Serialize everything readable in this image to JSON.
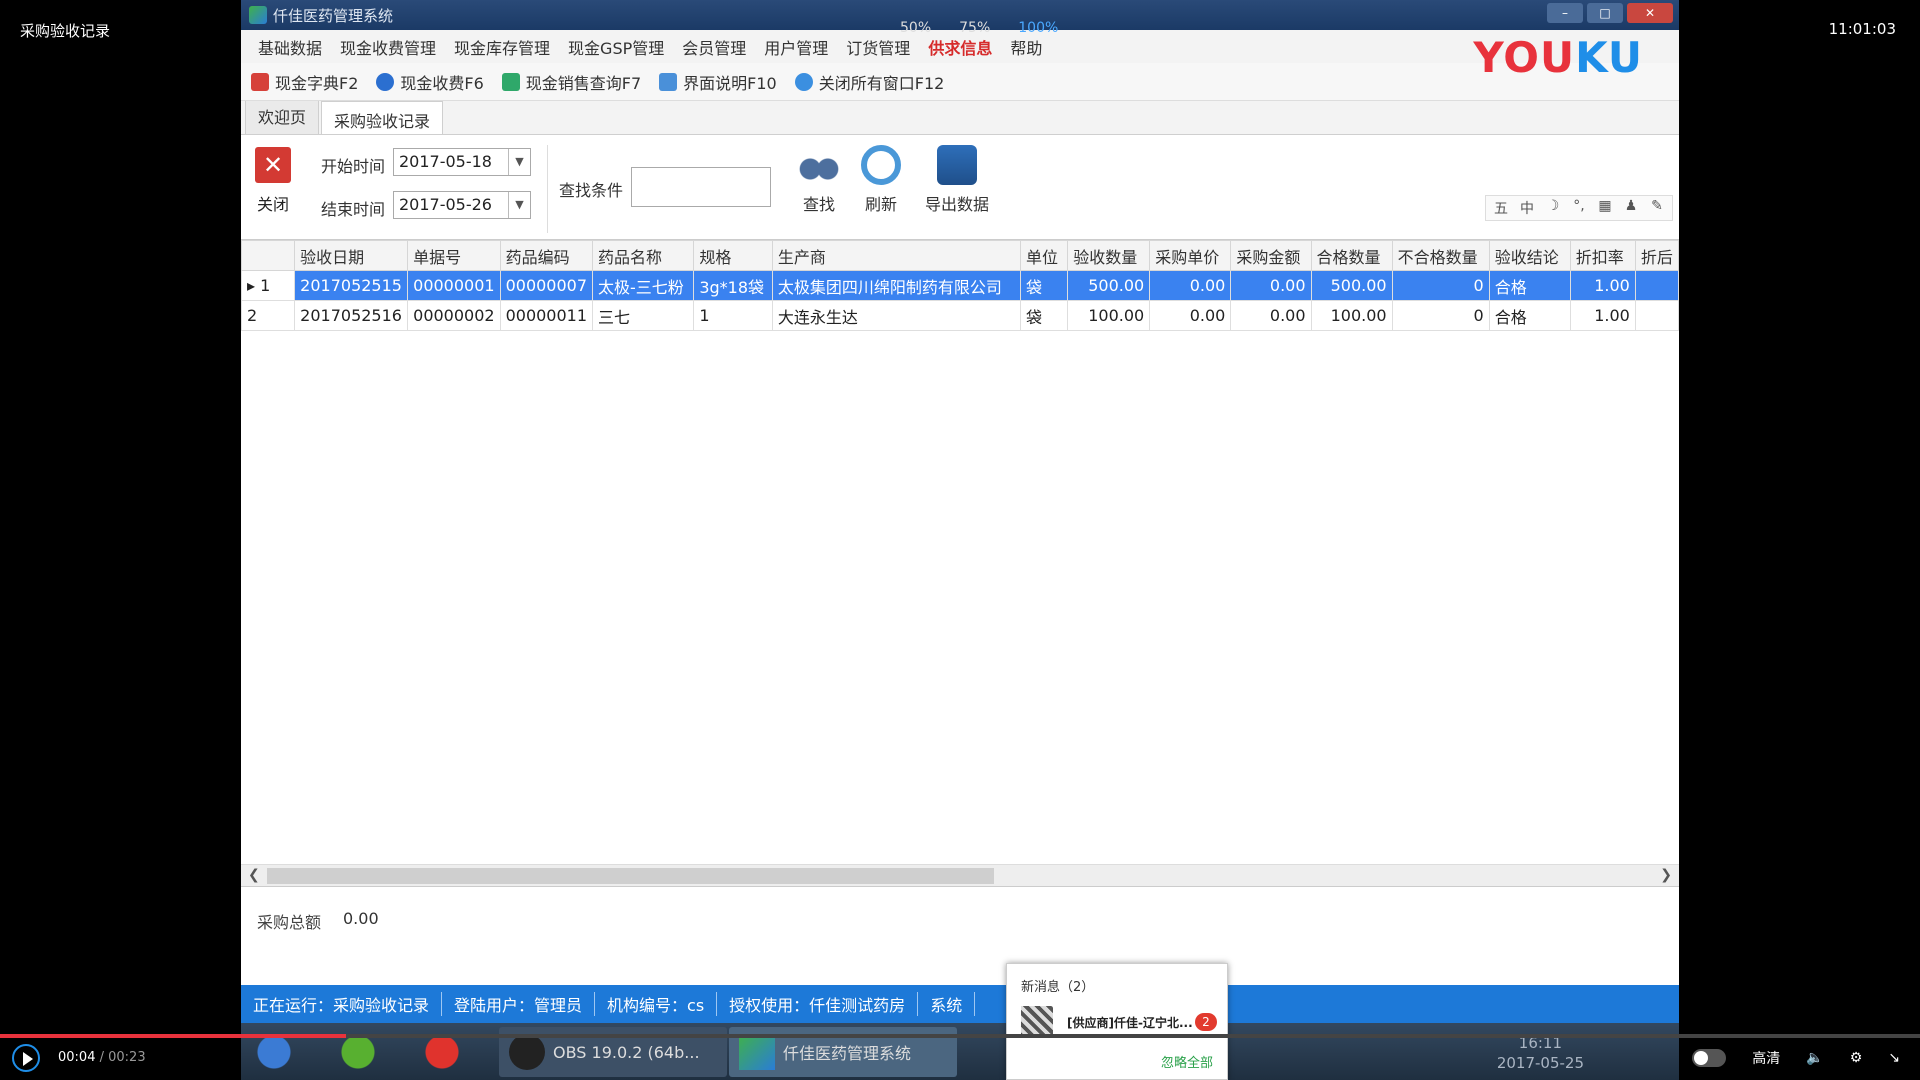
{
  "video": {
    "title": "采购验收记录",
    "clock": "11:01:03",
    "zoom_options": [
      "50%",
      "75%",
      "100%"
    ],
    "current_time": "00:04",
    "total_time": "/ 00:23",
    "quality": "高清",
    "progress_fraction": 0.18
  },
  "window": {
    "title": "仟佳医药管理系统",
    "logo": "YOUKU"
  },
  "menu": [
    "基础数据",
    "现金收费管理",
    "现金库存管理",
    "现金GSP管理",
    "会员管理",
    "用户管理",
    "订货管理",
    "供求信息",
    "帮助"
  ],
  "toolbar": [
    {
      "label": "现金字典F2",
      "color": "#d6413a"
    },
    {
      "label": "现金收费F6",
      "color": "#2b6fd0"
    },
    {
      "label": "现金销售查询F7",
      "color": "#2fa86a"
    },
    {
      "label": "界面说明F10",
      "color": "#4a90d9"
    },
    {
      "label": "关闭所有窗口F12",
      "color": "#3b8fe0"
    }
  ],
  "tabs": [
    "欢迎页",
    "采购验收记录"
  ],
  "query": {
    "close_label": "关闭",
    "start_label": "开始时间",
    "start_value": "2017-05-18",
    "end_label": "结束时间",
    "end_value": "2017-05-26",
    "search_label": "查找条件",
    "search_value": "",
    "find_label": "查找",
    "refresh_label": "刷新",
    "export_label": "导出数据"
  },
  "ime_icons": [
    "五",
    "中",
    "☽",
    "°,",
    "▦",
    "♟",
    "✎"
  ],
  "table": {
    "headers": [
      "",
      "验收日期",
      "单据号",
      "药品编码",
      "药品名称",
      "规格",
      "生产商",
      "单位",
      "验收数量",
      "采购单价",
      "采购金额",
      "合格数量",
      "不合格数量",
      "验收结论",
      "折扣率",
      "折后"
    ],
    "rows": [
      [
        "▸ 1",
        "2017052515",
        "00000001",
        "00000007",
        "太极-三七粉",
        "3g*18袋",
        "太极集团四川绵阳制药有限公司",
        "袋",
        "500.00",
        "0.00",
        "0.00",
        "500.00",
        "0",
        "合格",
        "1.00",
        ""
      ],
      [
        "2",
        "2017052516",
        "00000002",
        "00000011",
        "三七",
        "1",
        "大连永生达",
        "袋",
        "100.00",
        "0.00",
        "0.00",
        "100.00",
        "0",
        "合格",
        "1.00",
        ""
      ]
    ]
  },
  "summary": {
    "label": "采购总额",
    "value": "0.00"
  },
  "status": [
    "正在运行：采购验收记录",
    "登陆用户：管理员",
    "机构编号：cs",
    "授权使用：仟佳测试药房",
    "系统"
  ],
  "taskbar": {
    "obs_label": "OBS 19.0.2 (64b...",
    "app_label": "仟佳医药管理系统",
    "time": "16:11",
    "date": "2017-05-25"
  },
  "notification": {
    "title": "新消息（2）",
    "message": "[供应商]仟佳-辽宁北...",
    "count": "2",
    "ignore": "忽略全部"
  }
}
